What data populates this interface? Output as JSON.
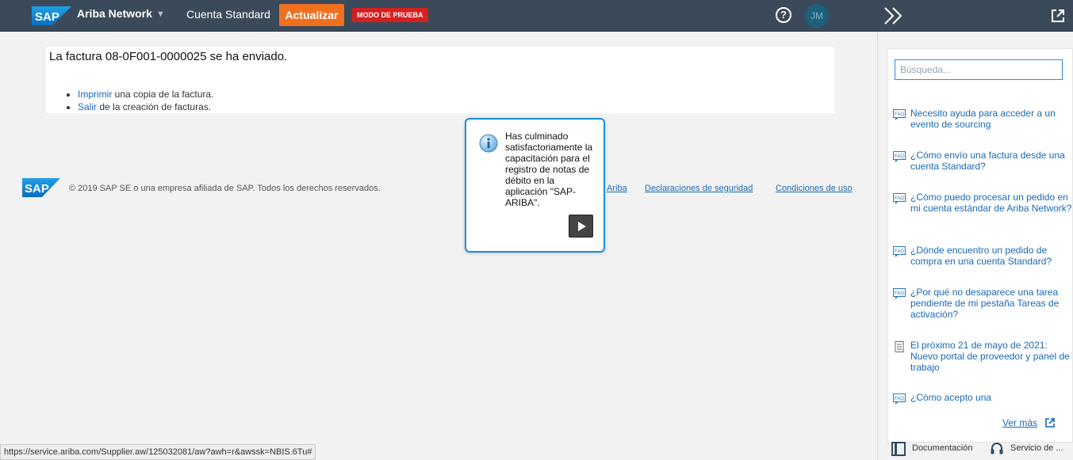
{
  "topbar": {
    "logo_text": "SAP",
    "brand": "Ariba Network",
    "account": "Cuenta Standard",
    "upgrade_label": "Actualizar",
    "test_badge": "MODO DE PRUEBA",
    "help_symbol": "?",
    "avatar_initials": "JM",
    "accent_color": "#f0701f",
    "bar_color": "#3b4a5a"
  },
  "main": {
    "title": "La factura 08-0F001-0000025 se ha enviado.",
    "items": [
      {
        "link": "Imprimir",
        "text": " una copia de la factura."
      },
      {
        "link": "Salir",
        "text": " de la creación de facturas."
      }
    ]
  },
  "footer": {
    "logo_text": "SAP",
    "copyright": "© 2019 SAP SE o una empresa afiliada de SAP. Todos los derechos reservados.",
    "links": [
      "Ariba",
      "Declaraciones de seguridad",
      "Condiciones de uso"
    ]
  },
  "popup": {
    "message": "Has culminado satisfactoriamente la capacitación para el registro de notas de débito en la aplicación \"SAP-ARIBA\"."
  },
  "side": {
    "search_placeholder": "Búsqueda...",
    "items": [
      {
        "icon": "faq-icon",
        "text": "Necesito ayuda para acceder a un evento de sourcing"
      },
      {
        "icon": "faq-icon",
        "text": "¿Cómo envío una factura desde una cuenta Standard?"
      },
      {
        "icon": "faq-icon",
        "text": "¿Cómo puedo procesar un pedido en mi cuenta estándar de Ariba Network?"
      },
      {
        "icon": "faq-icon",
        "text": "¿Dónde encuentro un pedido de compra en una cuenta Standard?"
      },
      {
        "icon": "faq-icon",
        "text": "¿Por qué no desaparece una tarea pendiente de mi pestaña Tareas de activación?"
      },
      {
        "icon": "document-icon",
        "text": "El próximo 21 de mayo de 2021: Nuevo portal de proveedor y panel de trabajo"
      },
      {
        "icon": "faq-icon",
        "text": "¿Cómo acepto una"
      }
    ],
    "see_more": "Ver más",
    "documentation": "Documentación",
    "service": "Servicio de ..."
  },
  "status_bar": {
    "url": "https://service.ariba.com/Supplier.aw/125032081/aw?awh=r&awssk=NBIS.6Tu#"
  }
}
